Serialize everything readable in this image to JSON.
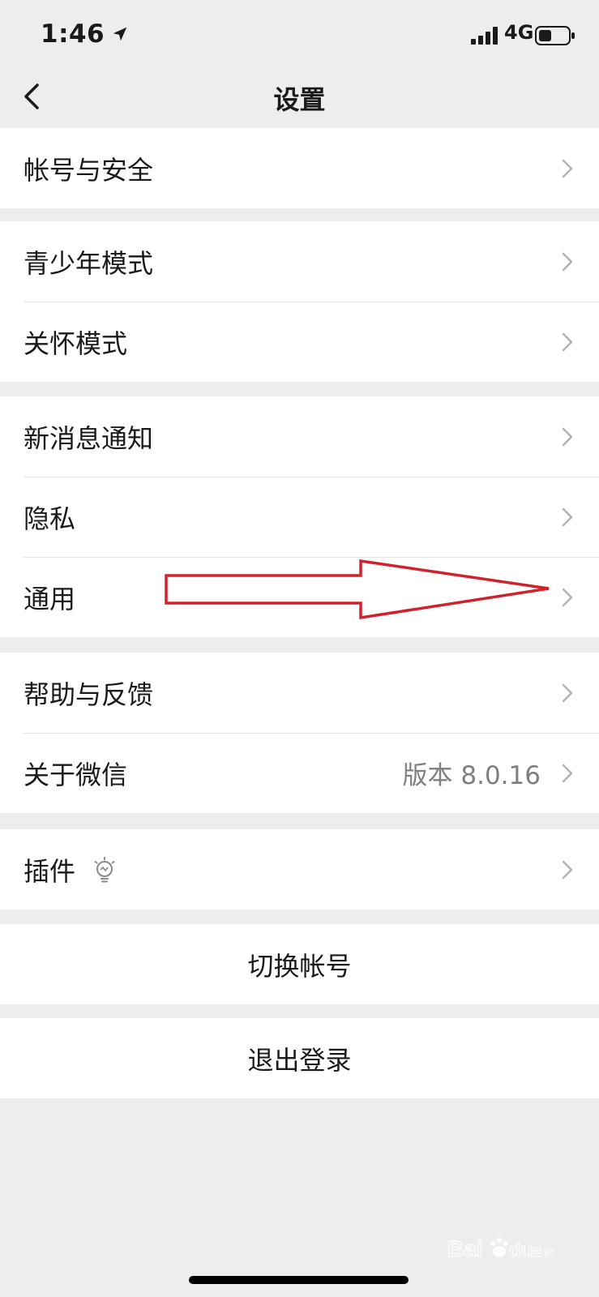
{
  "status_bar": {
    "time": "1:46",
    "network": "4G"
  },
  "header": {
    "title": "设置",
    "back_icon": "chevron-left-icon"
  },
  "groups": [
    {
      "items": [
        {
          "label": "帐号与安全"
        }
      ]
    },
    {
      "items": [
        {
          "label": "青少年模式"
        },
        {
          "label": "关怀模式"
        }
      ]
    },
    {
      "items": [
        {
          "label": "新消息通知"
        },
        {
          "label": "隐私"
        },
        {
          "label": "通用"
        }
      ]
    },
    {
      "items": [
        {
          "label": "帮助与反馈"
        },
        {
          "label": "关于微信",
          "value": "版本 8.0.16"
        }
      ]
    },
    {
      "items": [
        {
          "label": "插件",
          "icon": "lightbulb-icon"
        }
      ]
    }
  ],
  "actions": {
    "switch_account": "切换帐号",
    "logout": "退出登录"
  },
  "annotation": {
    "type": "red-arrow",
    "color": "#d0222b",
    "points_to": "通用"
  },
  "watermark": {
    "text": "Baidu经验"
  },
  "colors": {
    "background": "#ededed",
    "cell": "#ffffff",
    "separator": "#e5e5e5",
    "secondary_text": "#7f7f7f",
    "chevron": "#b2b2b2"
  }
}
